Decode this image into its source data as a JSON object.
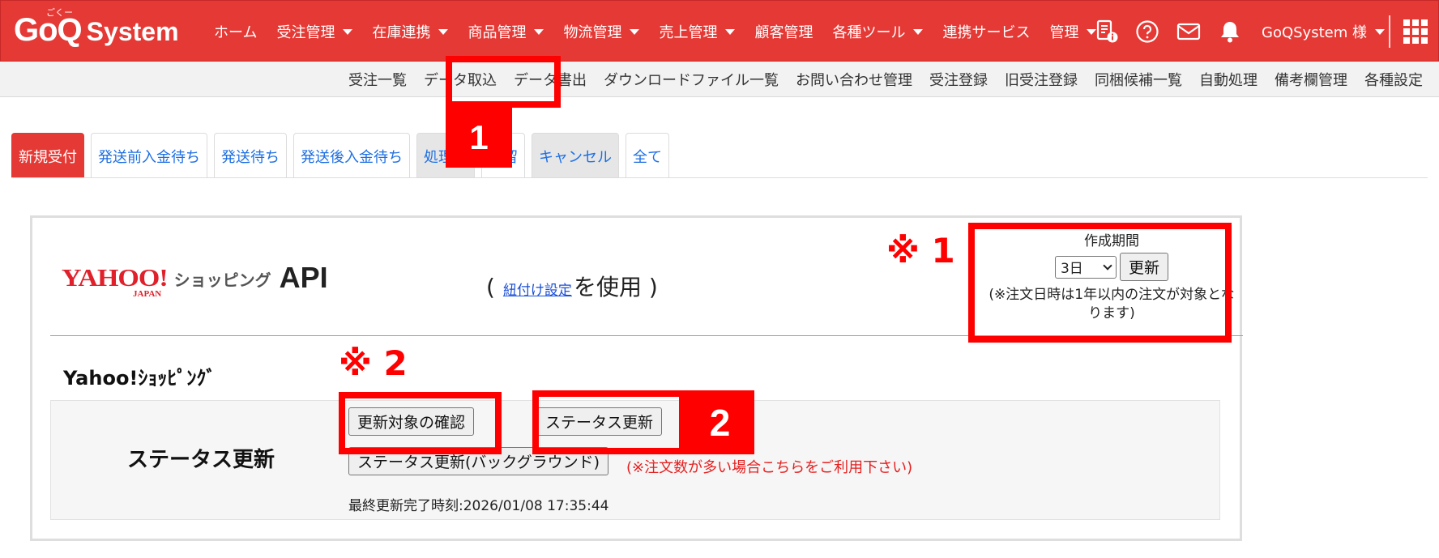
{
  "brand": {
    "logo_main": "GoQ",
    "logo_sub": "System",
    "logo_ruby": "ごくー"
  },
  "nav": {
    "items": [
      {
        "label": "ホーム",
        "dropdown": false
      },
      {
        "label": "受注管理",
        "dropdown": true
      },
      {
        "label": "在庫連携",
        "dropdown": true
      },
      {
        "label": "商品管理",
        "dropdown": true
      },
      {
        "label": "物流管理",
        "dropdown": true
      },
      {
        "label": "売上管理",
        "dropdown": true
      },
      {
        "label": "顧客管理",
        "dropdown": false
      },
      {
        "label": "各種ツール",
        "dropdown": true
      },
      {
        "label": "連携サービス",
        "dropdown": false
      },
      {
        "label": "管理",
        "dropdown": true
      }
    ],
    "user_label": "GoQSystem 様",
    "icons": [
      "document-info-icon",
      "help-icon",
      "mail-icon",
      "bell-icon",
      "apps-grid-icon"
    ]
  },
  "submenu": {
    "items": [
      "受注一覧",
      "データ取込",
      "データ書出",
      "ダウンロードファイル一覧",
      "お問い合わせ管理",
      "受注登録",
      "旧受注登録",
      "同梱候補一覧",
      "自動処理",
      "備考欄管理",
      "各種設定"
    ]
  },
  "tabs": [
    {
      "label": "新規受付",
      "state": "active"
    },
    {
      "label": "発送前入金待ち",
      "state": "normal"
    },
    {
      "label": "発送待ち",
      "state": "normal"
    },
    {
      "label": "発送後入金待ち",
      "state": "normal"
    },
    {
      "label": "処理済",
      "state": "gray"
    },
    {
      "label": "保留",
      "state": "normal"
    },
    {
      "label": "キャンセル",
      "state": "gray"
    },
    {
      "label": "全て",
      "state": "normal"
    }
  ],
  "panel": {
    "logo": {
      "yahoo": "YAHOO!",
      "japan": "JAPAN",
      "shopping": "ショッピング",
      "api": "API"
    },
    "link_prefix": "(",
    "link_text": "紐付け設定",
    "link_suffix": "を使用 )",
    "period": {
      "label": "作成期間",
      "selected": "3日",
      "button": "更新",
      "note": "(※注文日時は1年以内の注文が対象となります)"
    },
    "shop_title": "Yahoo!ｼｮｯﾋﾟﾝｸﾞ",
    "status": {
      "label": "ステータス更新",
      "check_button": "更新対象の確認",
      "update_button": "ステータス更新",
      "background_button": "ステータス更新(バックグラウンド)",
      "background_note": "(※注文数が多い場合こちらをご利用下さい)",
      "last_update": "最終更新完了時刻:2026/01/08 17:35:44"
    }
  },
  "annotations": {
    "badge1": "1",
    "badge2": "2",
    "note1": "※ 1",
    "note2": "※ 2"
  },
  "colors": {
    "brand_red": "#e53935",
    "annotation_red": "#ff0000",
    "link_blue": "#1e6fe3"
  }
}
